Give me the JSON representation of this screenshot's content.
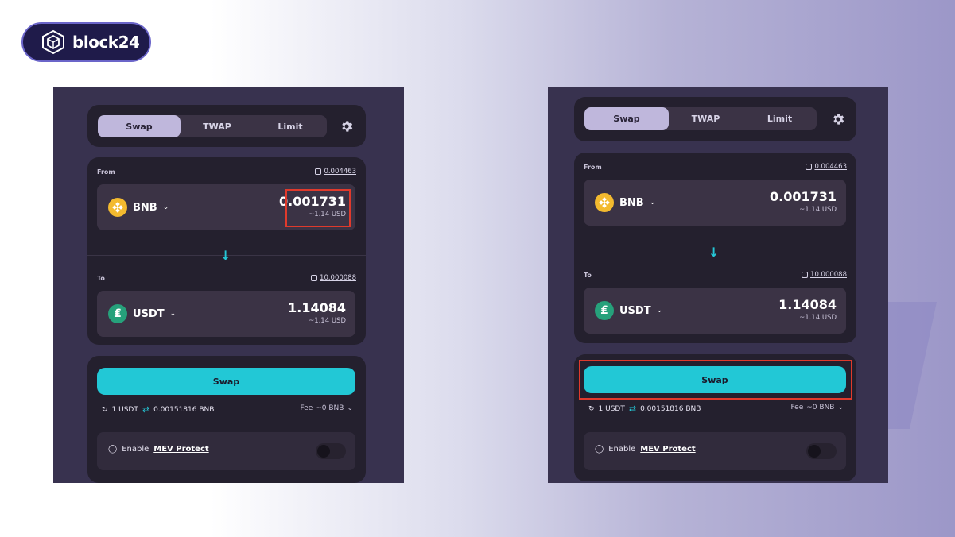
{
  "brand": {
    "name": "block24"
  },
  "colors": {
    "accent": "#22c8d6",
    "highlight": "#e03a2c",
    "bnb": "#f3ba2f",
    "usdt": "#26a17b"
  },
  "tabs": [
    "Swap",
    "TWAP",
    "Limit"
  ],
  "from": {
    "label": "From",
    "balance": "0.004463",
    "token": "BNB",
    "amount": "0.001731",
    "usd": "~1.14 USD",
    "icon": "bnb-icon"
  },
  "to": {
    "label": "To",
    "balance": "10.000088",
    "token": "USDT",
    "amount": "1.14084",
    "usd": "~1.14 USD",
    "icon": "usdt-icon"
  },
  "swap_button": "Swap",
  "rate": {
    "left": "1 USDT",
    "right": "0.00151816 BNB"
  },
  "fee": {
    "label": "Fee",
    "value": "~0 BNB"
  },
  "mev": {
    "prefix": "Enable",
    "name": "MEV Protect",
    "enabled": false
  }
}
